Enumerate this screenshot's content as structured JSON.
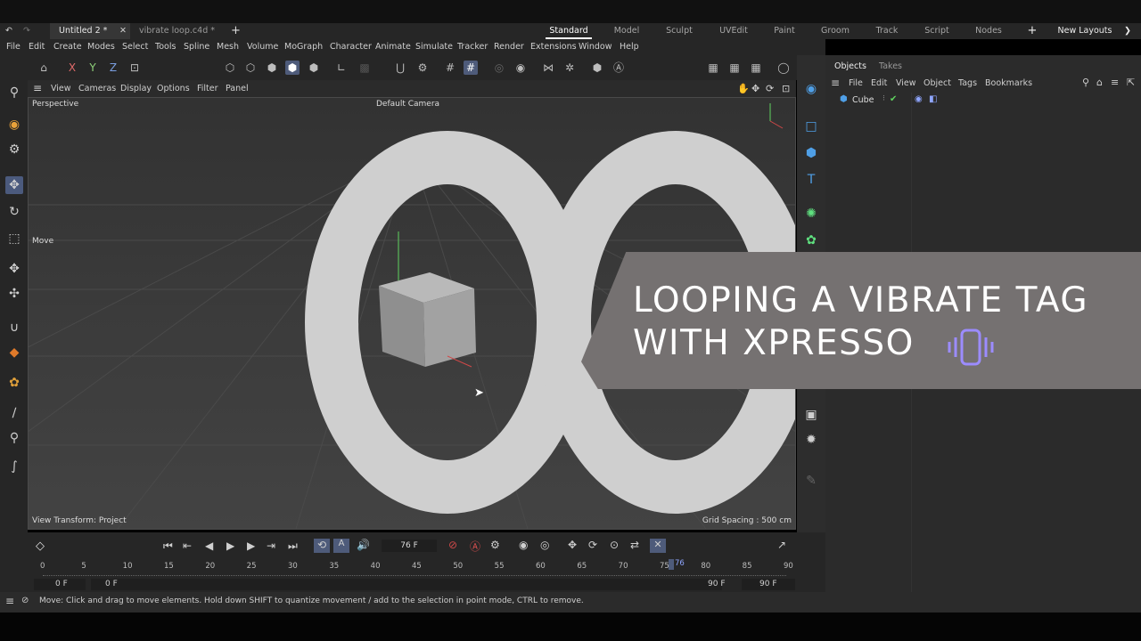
{
  "window_tabs": [
    {
      "label": "Untitled 2 *",
      "active": true
    },
    {
      "label": "vibrate loop.c4d *",
      "active": false
    }
  ],
  "layouts": {
    "items": [
      "Standard",
      "Model",
      "Sculpt",
      "UVEdit",
      "Paint",
      "Groom",
      "Track",
      "Script",
      "Nodes"
    ],
    "active": "Standard",
    "new_layouts_label": "New Layouts"
  },
  "menu": [
    "File",
    "Edit",
    "Create",
    "Modes",
    "Select",
    "Tools",
    "Spline",
    "Mesh",
    "Volume",
    "MoGraph",
    "Character",
    "Animate",
    "Simulate",
    "Tracker",
    "Render",
    "Extensions",
    "Window",
    "Help"
  ],
  "toolbar": {
    "axis_x": "X",
    "axis_y": "Y",
    "axis_z": "Z"
  },
  "viewport_menu": [
    "View",
    "Cameras",
    "Display",
    "Options",
    "Filter",
    "Panel"
  ],
  "viewport": {
    "label": "Perspective",
    "camera": "Default Camera",
    "tool_label": "Move",
    "view_transform": "View Transform: Project",
    "grid_spacing": "Grid Spacing : 500 cm"
  },
  "overlay": {
    "line1": "LOOPING A VIBRATE TAG",
    "line2": "WITH XPRESSO"
  },
  "objects_panel": {
    "tabs": [
      "Objects",
      "Takes"
    ],
    "menu": [
      "File",
      "Edit",
      "View",
      "Object",
      "Tags",
      "Bookmarks"
    ],
    "object_name": "Cube"
  },
  "timeline": {
    "current_frame": "76 F",
    "ticks": [
      "0",
      "5",
      "10",
      "15",
      "20",
      "25",
      "30",
      "35",
      "40",
      "45",
      "50",
      "55",
      "60",
      "65",
      "70",
      "75",
      "80",
      "85",
      "90"
    ],
    "playhead": "76",
    "start_a": "0 F",
    "start_b": "0 F",
    "end_a": "90 F",
    "end_b": "90 F"
  },
  "status": "Move: Click and drag to move elements. Hold down SHIFT to quantize movement / add to the selection in point mode, CTRL to remove.",
  "colors": {
    "accent": "#4e5b7a",
    "overlay_band": "#757171",
    "infinity": "#cfcfcf",
    "viewport_bg": "#3a3a3a"
  }
}
